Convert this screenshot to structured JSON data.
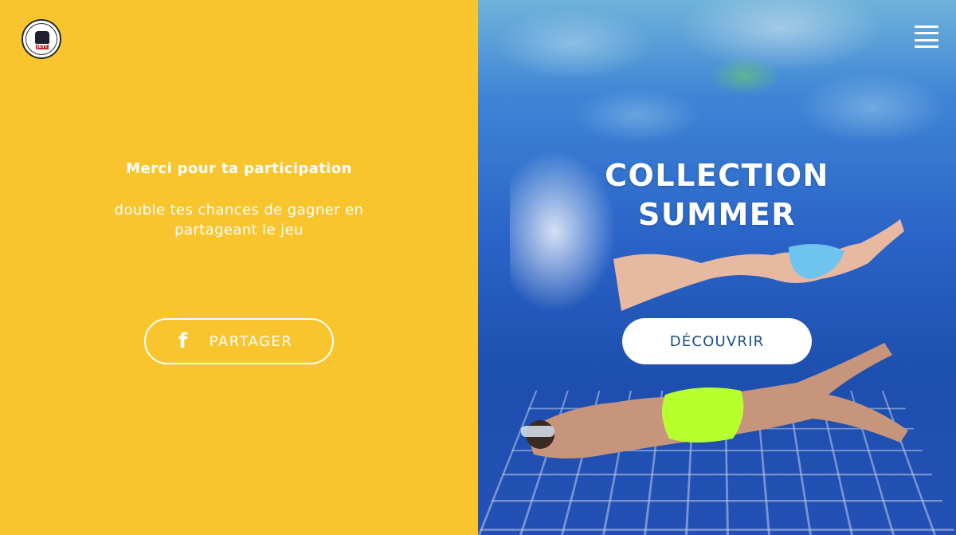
{
  "brand": {
    "logo_text": "Just Over The Top",
    "logo_badge": "JOTT"
  },
  "left": {
    "title": "Merci pour ta participation",
    "subtitle": "double tes chances de gagner en partageant le jeu",
    "share_button": {
      "icon": "facebook-icon",
      "label": "PARTAGER"
    }
  },
  "right": {
    "title_line1": "COLLECTION",
    "title_line2": "SUMMER",
    "discover_label": "DÉCOUVRIR",
    "menu_icon": "hamburger-icon"
  },
  "colors": {
    "left_bg": "#f9c52f",
    "text": "#ffffff",
    "discover_text": "#1a4d86"
  }
}
